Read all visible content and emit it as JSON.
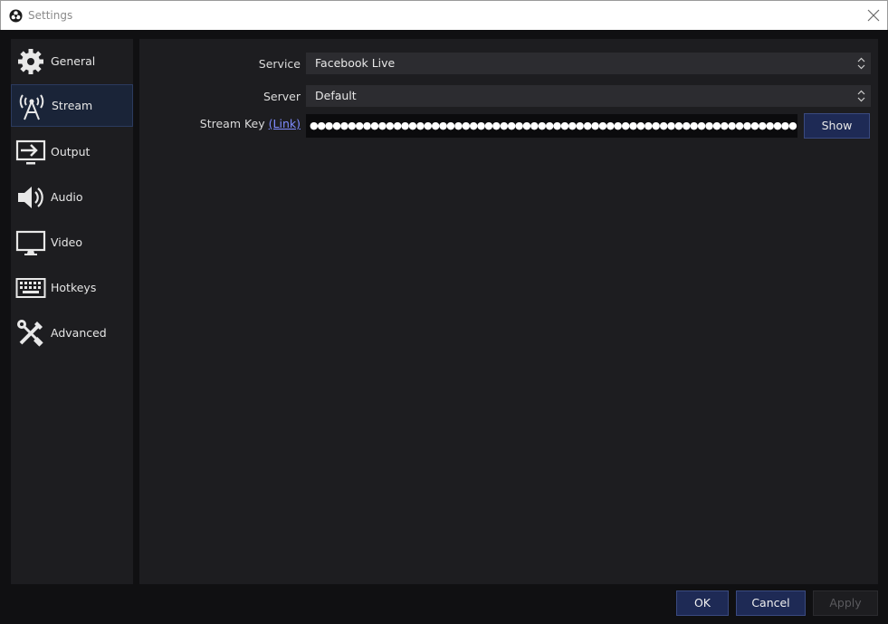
{
  "window": {
    "title": "Settings"
  },
  "sidebar": {
    "items": [
      {
        "label": "General",
        "icon": "gear-icon",
        "active": false
      },
      {
        "label": "Stream",
        "icon": "broadcast-tower-icon",
        "active": true
      },
      {
        "label": "Output",
        "icon": "output-monitor-icon",
        "active": false
      },
      {
        "label": "Audio",
        "icon": "speaker-icon",
        "active": false
      },
      {
        "label": "Video",
        "icon": "monitor-icon",
        "active": false
      },
      {
        "label": "Hotkeys",
        "icon": "keyboard-icon",
        "active": false
      },
      {
        "label": "Advanced",
        "icon": "tools-icon",
        "active": false
      }
    ]
  },
  "stream": {
    "service_label": "Service",
    "service_value": "Facebook Live",
    "server_label": "Server",
    "server_value": "Default",
    "key_label": "Stream Key",
    "key_link": "(Link)",
    "key_value": "●●●●●●●●●●●●●●●●●●●●●●●●●●●●●●●●●●●●●●●●●●●●●●●●●●●●●●●●●●●●●●●●",
    "show_label": "Show"
  },
  "footer": {
    "ok_label": "OK",
    "cancel_label": "Cancel",
    "apply_label": "Apply"
  },
  "colors": {
    "accent": "#1e2a55",
    "panel": "#1d1d20",
    "background": "#101012",
    "link": "#7f8cff"
  }
}
